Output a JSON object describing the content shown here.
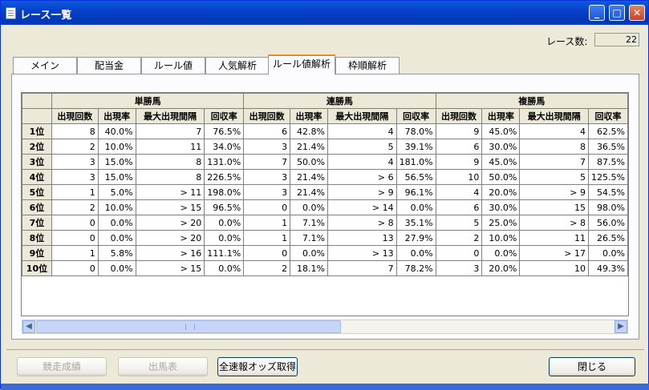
{
  "window": {
    "title": "レース一覧"
  },
  "race_count": {
    "label": "レース数:",
    "value": "22"
  },
  "tabs": [
    "メイン",
    "配当金",
    "ルール値",
    "人気解析",
    "ルール値解析",
    "枠順解析"
  ],
  "active_tab": 4,
  "grid": {
    "groups": [
      "単勝馬",
      "連勝馬",
      "複勝馬"
    ],
    "columns": [
      "出現回数",
      "出現率",
      "最大出現間隔",
      "回収率"
    ],
    "rows": [
      {
        "label": "1位",
        "cells": [
          "8",
          "40.0%",
          "7",
          "76.5%",
          "6",
          "42.8%",
          "4",
          "78.0%",
          "9",
          "45.0%",
          "4",
          "62.5%"
        ]
      },
      {
        "label": "2位",
        "cells": [
          "2",
          "10.0%",
          "11",
          "34.0%",
          "3",
          "21.4%",
          "5",
          "39.1%",
          "6",
          "30.0%",
          "8",
          "36.5%"
        ]
      },
      {
        "label": "3位",
        "cells": [
          "3",
          "15.0%",
          "8",
          "131.0%",
          "7",
          "50.0%",
          "4",
          "181.0%",
          "9",
          "45.0%",
          "7",
          "87.5%"
        ]
      },
      {
        "label": "4位",
        "cells": [
          "3",
          "15.0%",
          "8",
          "226.5%",
          "3",
          "21.4%",
          "> 6",
          "56.5%",
          "10",
          "50.0%",
          "5",
          "125.5%"
        ]
      },
      {
        "label": "5位",
        "cells": [
          "1",
          "5.0%",
          "> 11",
          "198.0%",
          "3",
          "21.4%",
          "> 9",
          "96.1%",
          "4",
          "20.0%",
          "> 9",
          "54.5%"
        ]
      },
      {
        "label": "6位",
        "cells": [
          "2",
          "10.0%",
          "> 15",
          "96.5%",
          "0",
          "0.0%",
          "> 14",
          "0.0%",
          "6",
          "30.0%",
          "15",
          "98.0%"
        ]
      },
      {
        "label": "7位",
        "cells": [
          "0",
          "0.0%",
          "> 20",
          "0.0%",
          "1",
          "7.1%",
          "> 8",
          "35.1%",
          "5",
          "25.0%",
          "> 8",
          "56.0%"
        ]
      },
      {
        "label": "8位",
        "cells": [
          "0",
          "0.0%",
          "> 20",
          "0.0%",
          "1",
          "7.1%",
          "13",
          "27.9%",
          "2",
          "10.0%",
          "11",
          "26.5%"
        ]
      },
      {
        "label": "9位",
        "cells": [
          "1",
          "5.8%",
          "> 16",
          "111.1%",
          "0",
          "0.0%",
          "> 13",
          "0.0%",
          "0",
          "0.0%",
          "> 17",
          "0.0%"
        ]
      },
      {
        "label": "10位",
        "cells": [
          "0",
          "0.0%",
          "> 15",
          "0.0%",
          "2",
          "18.1%",
          "7",
          "78.2%",
          "3",
          "20.0%",
          "10",
          "49.3%"
        ]
      }
    ]
  },
  "buttons": {
    "race_results": "競走成績",
    "entries": "出馬表",
    "get_all_odds": "全速報オッズ取得",
    "close": "閉じる"
  },
  "icons": {
    "window_icon": "document-icon",
    "minimize": "minimize-icon",
    "maximize": "maximize-icon",
    "close": "close-icon",
    "scroll_left": "arrow-left-icon",
    "scroll_right": "arrow-right-icon"
  },
  "colors": {
    "titlebar": "#0a5be0",
    "active_tab_accent": "#e68b2c",
    "grid_header": "#ece9d8"
  }
}
